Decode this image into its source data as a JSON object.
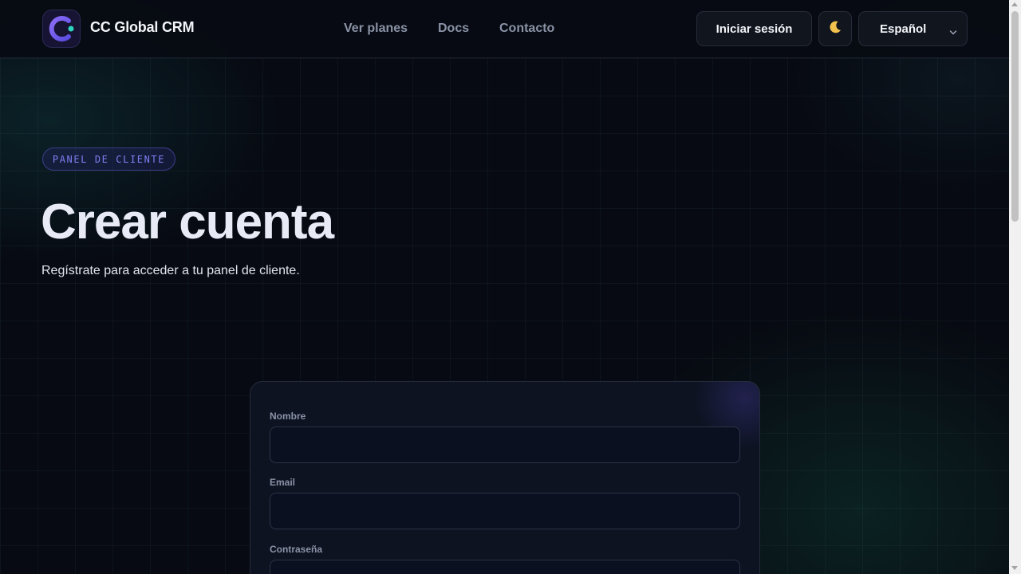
{
  "brand": {
    "name": "CC Global CRM",
    "icon": "crm-logo-icon"
  },
  "nav": {
    "links": [
      {
        "label": "Ver planes"
      },
      {
        "label": "Docs"
      },
      {
        "label": "Contacto"
      }
    ]
  },
  "header_actions": {
    "login_label": "Iniciar sesión",
    "theme_icon": "moon-icon",
    "language": {
      "selected": "Español",
      "icon": "chevron-down-icon"
    }
  },
  "hero": {
    "badge": "PANEL DE CLIENTE",
    "title": "Crear cuenta",
    "subtitle": "Regístrate para acceder a tu panel de cliente."
  },
  "form": {
    "fields": [
      {
        "label": "Nombre",
        "value": ""
      },
      {
        "label": "Email",
        "value": ""
      },
      {
        "label": "Contraseña",
        "value": ""
      }
    ]
  },
  "colors": {
    "background": "#070a12",
    "accent": "#6d5cf0",
    "accent_secondary": "#2dd4bf",
    "card": "#0e1322"
  }
}
